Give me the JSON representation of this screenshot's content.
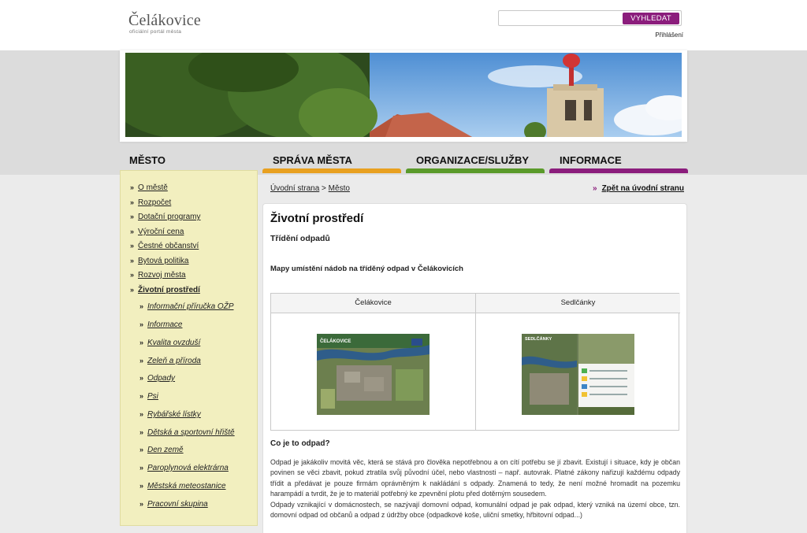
{
  "header": {
    "logo_title": "Čelákovice",
    "logo_subtitle": "oficiální portál města",
    "search_placeholder": "",
    "search_button": "VYHLEDAT",
    "login_link": "Přihlášení"
  },
  "nav": {
    "city": "MĚSTO",
    "items": [
      {
        "label": "SPRÁVA MĚSTA",
        "color": "#e8a020"
      },
      {
        "label": "ORGANIZACE/SLUŽBY",
        "color": "#5a9a2a"
      },
      {
        "label": "INFORMACE",
        "color": "#8b1d7c"
      }
    ]
  },
  "sidebar": {
    "items": [
      "O městě",
      "Rozpočet",
      "Dotační programy",
      "Výroční cena",
      "Čestné občanství",
      "Bytová politika",
      "Rozvoj města",
      "Životní prostředí"
    ],
    "subitems": [
      "Informační příručka OŽP",
      "Informace",
      "Kvalita ovzduší",
      "Zeleň a příroda",
      "Odpady",
      "Psi",
      "Rybářské lístky",
      "Dětská a sportovní hřiště",
      "Den země",
      "Paroplynová elektrárna",
      "Městská meteostanice",
      "Pracovní skupina"
    ]
  },
  "breadcrumb": {
    "home": "Úvodní strana",
    "separator": ">",
    "current": "Město"
  },
  "back_link": "Zpět na úvodní stranu",
  "content": {
    "title": "Životní prostředí",
    "subtitle": "Třídění odpadů",
    "maps_heading": "Mapy umístění nádob na tříděný odpad v Čelákovicích",
    "maps": [
      {
        "label": "Čelákovice",
        "thumb_label": "ČELÁKOVICE"
      },
      {
        "label": "Sedlčánky",
        "thumb_label": "SEDLČÁNKY"
      }
    ],
    "question": "Co je to odpad?",
    "paragraph1": "Odpad je jakákoliv movitá věc, která se stává pro člověka nepotřebnou a on cítí potřebu se jí zbavit. Existují i situace, kdy je občan povinen se věci zbavit, pokud  ztratila svůj původní účel, nebo vlastnosti – např. autovrak. Platné zákony nařizují každému odpady třídit a předávat je pouze firmám oprávněným k nakládání s odpady. Znamená to tedy, že není možné hromadit na pozemku harampádí a tvrdit, že  je to materiál potřebný ke zpevnění plotu před dotěrným sousedem.",
    "paragraph2": "Odpady vznikající v domácnostech, se nazývají domovní odpad,  komunální odpad je pak odpad, který vzniká na území obce, tzn. domovní odpad od občanů a odpad z údržby obce (odpadkové koše, uliční smetky, hřbitovní odpad...)"
  }
}
